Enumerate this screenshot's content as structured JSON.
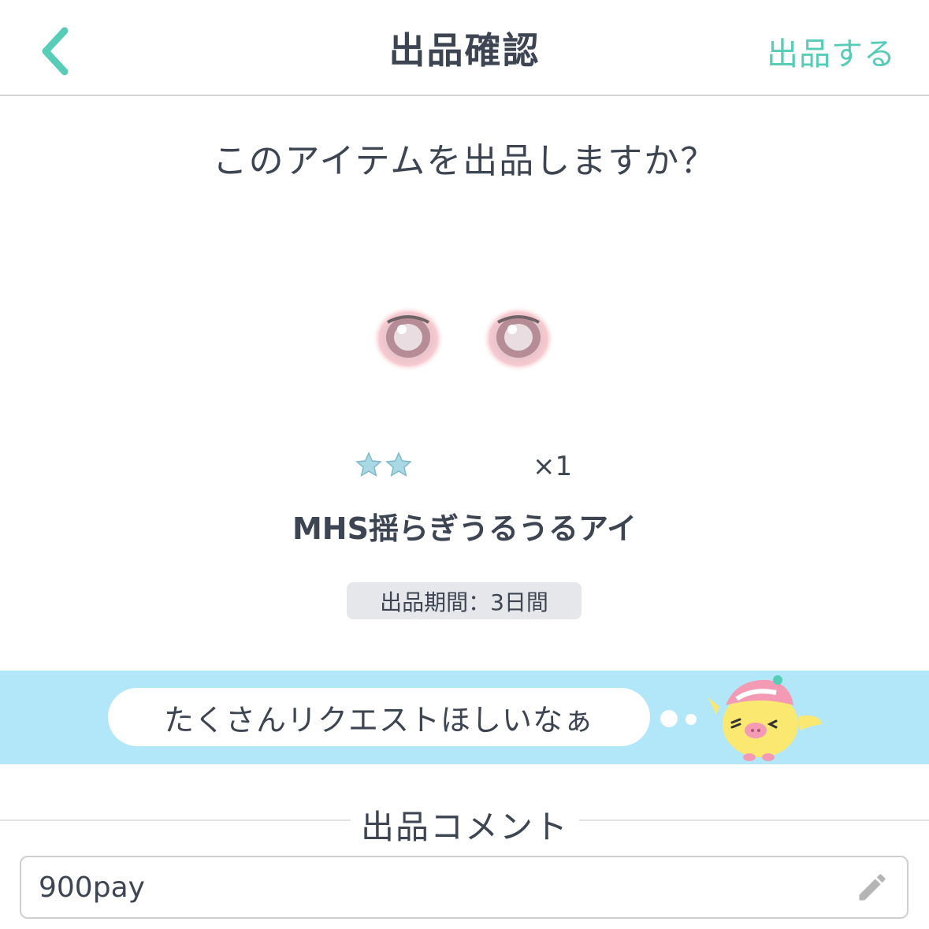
{
  "header": {
    "title": "出品確認",
    "submit_label": "出品する",
    "accent_color": "#57ccb7",
    "back_icon": "chevron-left-icon"
  },
  "confirm": {
    "question": "このアイテムを出品しますか？"
  },
  "item": {
    "rarity_stars": 2,
    "quantity": "×1",
    "name": "MHS揺らぎうるうるアイ",
    "period": "出品期間：3日間"
  },
  "banner": {
    "message": "たくさんリクエストほしいなぁ",
    "background": "#b2e7f9"
  },
  "comment": {
    "label": "出品コメント",
    "value": "900pay",
    "edit_icon": "pencil-icon"
  }
}
